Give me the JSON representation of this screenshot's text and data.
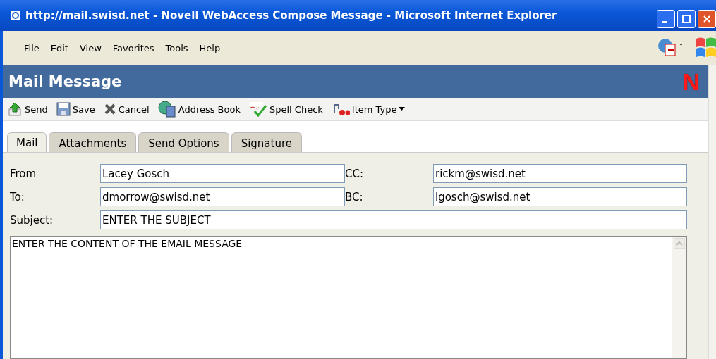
{
  "window": {
    "title": "http://mail.swisd.net - Novell WebAccess Compose Message - Microsoft Internet Explorer"
  },
  "menu": [
    "File",
    "Edit",
    "View",
    "Favorites",
    "Tools",
    "Help"
  ],
  "header": {
    "title": "Mail Message",
    "logo": "N"
  },
  "toolbar": [
    {
      "kind": "send",
      "label": "Send"
    },
    {
      "kind": "save",
      "label": "Save"
    },
    {
      "kind": "cancel",
      "label": "Cancel"
    },
    {
      "kind": "addressbook",
      "label": "Address Book"
    },
    {
      "kind": "spell",
      "label": "Spell Check"
    },
    {
      "kind": "itemtype",
      "label": "Item Type",
      "dropdown": true
    }
  ],
  "tabs": [
    {
      "label": "Mail",
      "selected": true
    },
    {
      "label": "Attachments",
      "selected": false
    },
    {
      "label": "Send Options",
      "selected": false
    },
    {
      "label": "Signature",
      "selected": false
    }
  ],
  "fields": {
    "from": {
      "label": "From",
      "value": "Lacey Gosch"
    },
    "cc": {
      "label": "CC:",
      "value": "rickm@swisd.net"
    },
    "to": {
      "label": "To:",
      "value": "dmorrow@swisd.net"
    },
    "bc": {
      "label": "BC:",
      "value": "lgosch@swisd.net"
    },
    "subject": {
      "label": "Subject:",
      "value": "ENTER THE SUBJECT"
    }
  },
  "body": {
    "value": "ENTER THE CONTENT OF THE EMAIL MESSAGE"
  }
}
